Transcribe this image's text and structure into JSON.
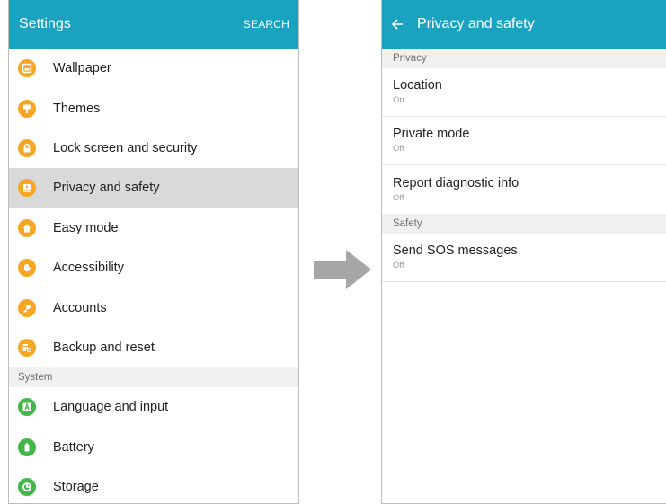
{
  "left": {
    "appbar": {
      "title": "Settings",
      "action": "SEARCH"
    },
    "items": [
      {
        "label": "Wallpaper",
        "icon": "wallpaper-icon",
        "color": "#f5a623",
        "selected": false
      },
      {
        "label": "Themes",
        "icon": "themes-icon",
        "color": "#f5a623",
        "selected": false
      },
      {
        "label": "Lock screen and security",
        "icon": "lock-icon",
        "color": "#f5a623",
        "selected": false
      },
      {
        "label": "Privacy and safety",
        "icon": "privacy-icon",
        "color": "#f5a623",
        "selected": true
      },
      {
        "label": "Easy mode",
        "icon": "home-icon",
        "color": "#f5a623",
        "selected": false
      },
      {
        "label": "Accessibility",
        "icon": "hand-icon",
        "color": "#f5a623",
        "selected": false
      },
      {
        "label": "Accounts",
        "icon": "key-icon",
        "color": "#f5a623",
        "selected": false
      },
      {
        "label": "Backup and reset",
        "icon": "backup-icon",
        "color": "#f5a623",
        "selected": false
      }
    ],
    "system_header": "System",
    "system_items": [
      {
        "label": "Language and input",
        "icon": "language-icon",
        "color": "#43b649"
      },
      {
        "label": "Battery",
        "icon": "battery-icon",
        "color": "#43b649"
      },
      {
        "label": "Storage",
        "icon": "storage-icon",
        "color": "#43b649"
      }
    ]
  },
  "right": {
    "appbar": {
      "title": "Privacy and safety"
    },
    "privacy_header": "Privacy",
    "privacy_items": [
      {
        "title": "Location",
        "status": "On"
      },
      {
        "title": "Private mode",
        "status": "Off"
      },
      {
        "title": "Report diagnostic info",
        "status": "Off"
      }
    ],
    "safety_header": "Safety",
    "safety_items": [
      {
        "title": "Send SOS messages",
        "status": "Off"
      }
    ]
  },
  "colors": {
    "appbar": "#1aa3c1",
    "orange_icon": "#f5a623",
    "green_icon": "#43b649",
    "arrow": "#a6a6a6"
  }
}
